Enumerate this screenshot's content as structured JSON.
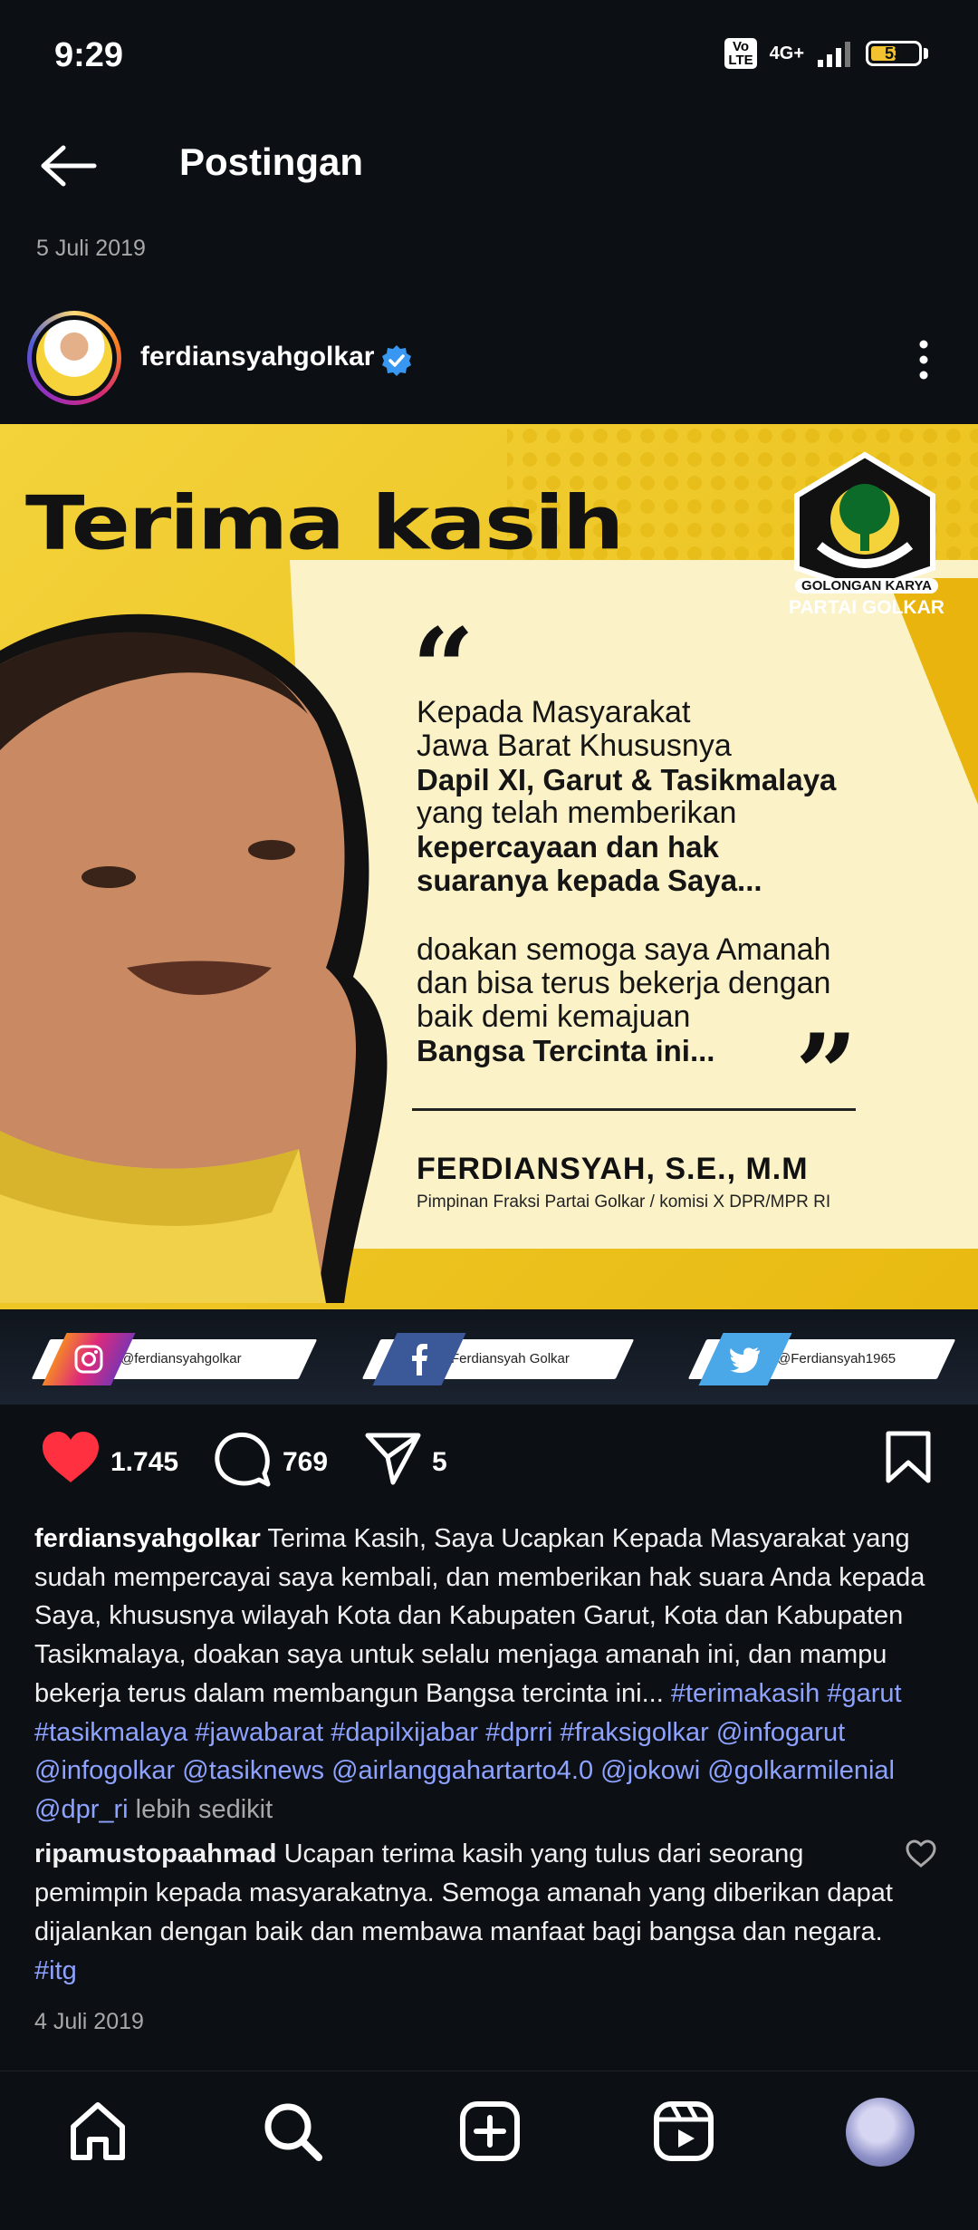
{
  "status": {
    "time": "9:29",
    "volte_line1": "Vo",
    "volte_line2": "LTE",
    "network": "4G+",
    "battery": "53",
    "battery_level": 0.53
  },
  "header": {
    "title": "Postingan",
    "back_icon": "arrow-left-icon"
  },
  "post": {
    "date": "5 Juli 2019",
    "username": "ferdiansyahgolkar",
    "verified": true,
    "image": {
      "headline": "Terima kasih",
      "logo_label_1": "GOLONGAN KARYA",
      "logo_label_2": "PARTAI GOLKAR",
      "quote": {
        "line1": "Kepada Masyarakat",
        "line2": "Jawa Barat Khususnya",
        "line3": "Dapil XI, Garut & Tasikmalaya",
        "line4": "yang telah memberikan",
        "line5": "kepercayaan dan hak",
        "line6": "suaranya kepada Saya...",
        "line7": "doakan semoga saya Amanah",
        "line8": "dan bisa terus bekerja dengan",
        "line9": "baik demi kemajuan",
        "line10": "Bangsa Tercinta ini..."
      },
      "signature_name": "FERDIANSYAH, S.E., M.M",
      "signature_role": "Pimpinan Fraksi Partai Golkar / komisi X DPR/MPR RI",
      "socials": {
        "instagram": "@ferdiansyahgolkar",
        "facebook": "Ferdiansyah Golkar",
        "twitter": "@Ferdiansyah1965"
      }
    },
    "likes": "1.745",
    "comments": "769",
    "shares": "5",
    "caption": {
      "username": "ferdiansyahgolkar",
      "text": "Terima Kasih, Saya Ucapkan Kepada Masyarakat yang sudah mempercayai saya kembali, dan memberikan hak suara Anda kepada Saya, khususnya wilayah Kota dan Kabupaten Garut, Kota dan Kabupaten Tasikmalaya, doakan saya untuk selalu menjaga amanah ini, dan mampu bekerja terus dalam membangun Bangsa tercinta ini...",
      "tags": [
        "#terimakasih",
        "#garut",
        "#tasikmalaya",
        "#jawabarat",
        "#dapilxijabar",
        "#dprri",
        "#fraksigolkar",
        "@infogarut",
        "@infogolkar",
        "@tasiknews",
        "@airlanggahartarto4.0",
        "@jokowi",
        "@golkarmilenial",
        "@dpr_ri"
      ],
      "less_label": "lebih sedikit"
    },
    "comment": {
      "username": "ripamustopaahmad",
      "text": "Ucapan terima kasih yang tulus dari seorang pemimpin kepada masyarakatnya. Semoga amanah yang diberikan dapat dijalankan dengan baik dan membawa manfaat bagi bangsa dan negara.",
      "tag": "#itg"
    },
    "secondary_date": "4 Juli 2019"
  },
  "colors": {
    "background": "#0c0f14",
    "like_red": "#ff3040",
    "link_blue": "#8ea2ff",
    "verified_blue": "#3897f0",
    "banner_yellow": "#f7e36a"
  },
  "bottom_nav": [
    "home-icon",
    "search-icon",
    "create-post-icon",
    "reels-icon",
    "profile-avatar"
  ]
}
